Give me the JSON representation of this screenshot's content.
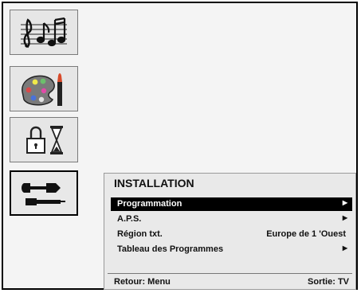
{
  "nav": {
    "items": [
      {
        "name": "sound",
        "icon": "music-notes-icon",
        "active": false
      },
      {
        "name": "picture",
        "icon": "palette-brush-icon",
        "active": false
      },
      {
        "name": "features",
        "icon": "lock-hourglass-icon",
        "active": false
      },
      {
        "name": "installation",
        "icon": "tools-icon",
        "active": true
      }
    ]
  },
  "menu": {
    "title": "INSTALLATION",
    "items": [
      {
        "label": "Programmation",
        "value": "",
        "arrow": "▶",
        "selected": true
      },
      {
        "label": "A.P.S.",
        "value": "",
        "arrow": "▶",
        "selected": false
      },
      {
        "label": "Région txt.",
        "value": "Europe de 1 'Ouest",
        "arrow": "",
        "selected": false
      },
      {
        "label": "Tableau des Programmes",
        "value": "",
        "arrow": "▶",
        "selected": false
      }
    ],
    "footer": {
      "left": "Retour: Menu",
      "right": "Sortie: TV"
    }
  },
  "colors": {
    "selection_bg": "#000000",
    "selection_fg": "#ffffff",
    "panel_bg": "#e9e9e9"
  }
}
